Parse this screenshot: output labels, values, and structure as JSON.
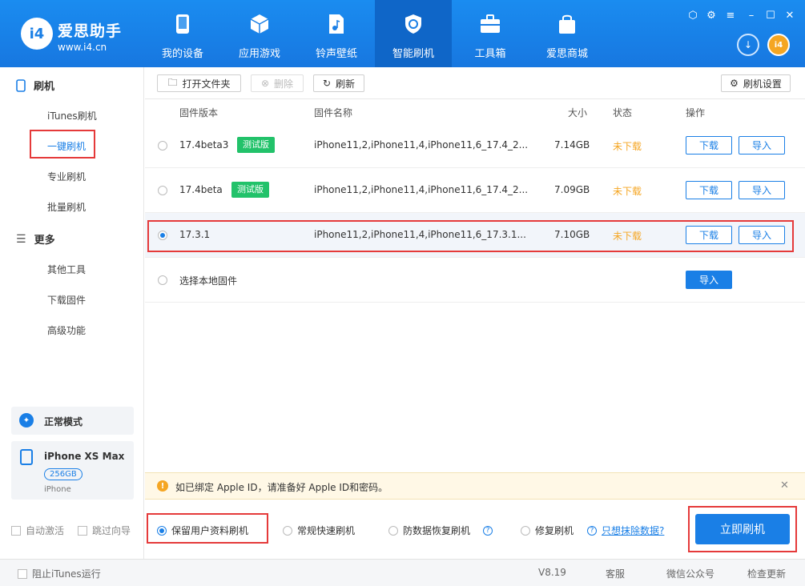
{
  "brand": {
    "name": "爱思助手",
    "url": "www.i4.cn",
    "logo_text": "i4"
  },
  "nav": [
    {
      "label": "我的设备",
      "icon": "phone-icon"
    },
    {
      "label": "应用游戏",
      "icon": "cube-icon"
    },
    {
      "label": "铃声壁纸",
      "icon": "music-file-icon"
    },
    {
      "label": "智能刷机",
      "icon": "refresh-shield-icon"
    },
    {
      "label": "工具箱",
      "icon": "toolbox-icon"
    },
    {
      "label": "爱思商城",
      "icon": "shopping-bag-icon"
    }
  ],
  "sidebar": {
    "section1": "刷机",
    "items1": [
      "iTunes刷机",
      "一键刷机",
      "专业刷机",
      "批量刷机"
    ],
    "section2": "更多",
    "items2": [
      "其他工具",
      "下载固件",
      "高级功能"
    ],
    "mode": "正常模式",
    "device": {
      "name": "iPhone XS Max",
      "storage": "256GB",
      "type": "iPhone"
    },
    "auto_activate": "自动激活",
    "skip_guide": "跳过向导"
  },
  "toolbar": {
    "open_folder": "打开文件夹",
    "delete": "删除",
    "refresh": "刷新",
    "settings": "刷机设置"
  },
  "table": {
    "headers": {
      "version": "固件版本",
      "name": "固件名称",
      "size": "大小",
      "status": "状态",
      "action": "操作"
    },
    "rows": [
      {
        "version": "17.4beta3",
        "tag": "测试版",
        "name": "iPhone11,2,iPhone11,4,iPhone11,6_17.4_2...",
        "size": "7.14GB",
        "status": "未下载",
        "download": "下载",
        "import": "导入"
      },
      {
        "version": "17.4beta",
        "tag": "测试版",
        "name": "iPhone11,2,iPhone11,4,iPhone11,6_17.4_2...",
        "size": "7.09GB",
        "status": "未下载",
        "download": "下载",
        "import": "导入"
      },
      {
        "version": "17.3.1",
        "tag": "",
        "name": "iPhone11,2,iPhone11,4,iPhone11,6_17.3.1...",
        "size": "7.10GB",
        "status": "未下载",
        "download": "下载",
        "import": "导入"
      }
    ],
    "local": {
      "label": "选择本地固件",
      "import": "导入"
    }
  },
  "warning": "如已绑定 Apple ID，请准备好 Apple ID和密码。",
  "options": {
    "keep_data": "保留用户资料刷机",
    "quick": "常规快速刷机",
    "anti_loss": "防数据恢复刷机",
    "repair": "修复刷机",
    "erase_link": "只想抹除数据?",
    "flash_now": "立即刷机"
  },
  "status": {
    "block_itunes": "阻止iTunes运行",
    "version": "V8.19",
    "service": "客服",
    "wechat": "微信公众号",
    "update": "检查更新"
  },
  "colors": {
    "accent": "#1a7fe6",
    "header": "#1777e0",
    "tag": "#22c26a",
    "status_orange": "#f5a623",
    "highlight": "#e53a3a"
  }
}
